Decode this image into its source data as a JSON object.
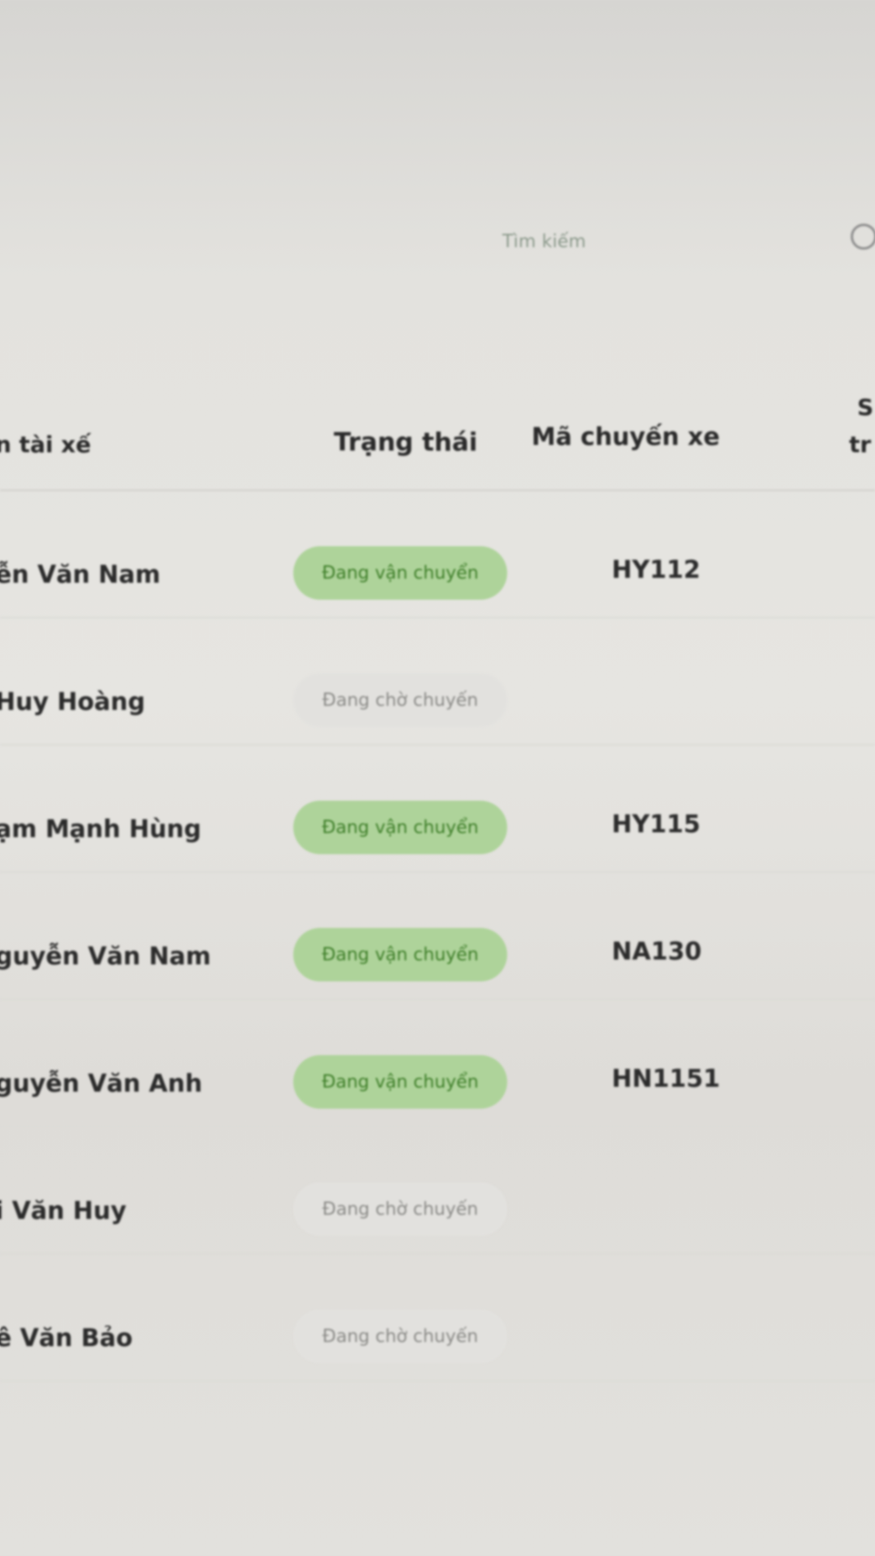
{
  "search": {
    "label": "Tìm kiếm",
    "icon": "search-icon"
  },
  "table": {
    "columns": {
      "driver_name": "n tài xế",
      "status": "Trạng thái",
      "trip_code": "Mã chuyến xe",
      "extra_line1": "S",
      "extra_line2": "tr"
    },
    "rows": [
      {
        "name": "ễn Văn Nam",
        "status": "Đang vận chuyển",
        "status_type": "moving",
        "trip": "HY112"
      },
      {
        "name": "Huy Hoàng",
        "status": "Đang chờ chuyến",
        "status_type": "waiting",
        "trip": ""
      },
      {
        "name": "ạm Mạnh Hùng",
        "status": "Đang vận chuyển",
        "status_type": "moving",
        "trip": "HY115"
      },
      {
        "name": "guyễn Văn Nam",
        "status": "Đang vận chuyển",
        "status_type": "moving",
        "trip": "NA130"
      },
      {
        "name": "guyễn Văn Anh",
        "status": "Đang vận chuyển",
        "status_type": "moving",
        "trip": "HN1151"
      },
      {
        "name": "i Văn Huy",
        "status": "Đang chờ chuyến",
        "status_type": "waiting",
        "trip": ""
      },
      {
        "name": "ê Văn Bảo",
        "status": "Đang chờ chuyến",
        "status_type": "waiting",
        "trip": ""
      }
    ]
  },
  "colors": {
    "moving_badge_bg": "#aed39a",
    "moving_badge_text": "#3f7f2a",
    "waiting_badge_bg": "#e2e1de",
    "waiting_badge_text": "#8b8b88"
  }
}
